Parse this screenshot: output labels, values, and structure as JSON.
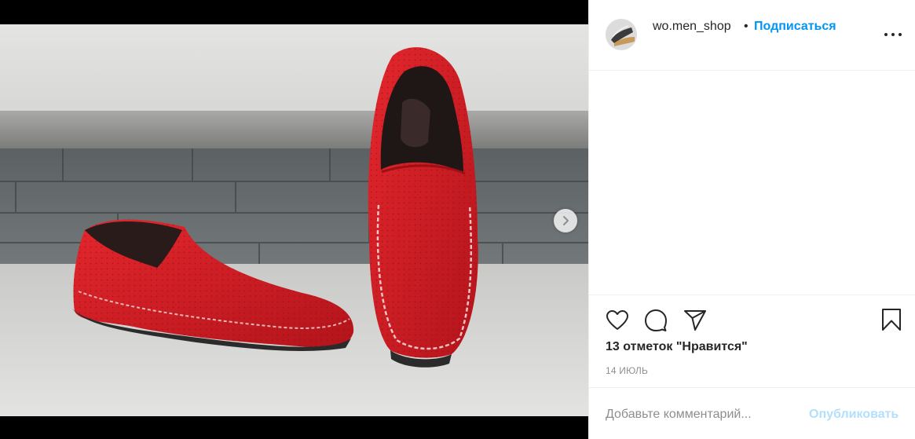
{
  "post": {
    "image_alt": "Red suede moccasins",
    "next_icon": "chevron-right-icon"
  },
  "header": {
    "username": "wo.men_shop",
    "separator": "•",
    "follow_label": "Подписаться",
    "more_icon": "more-horizontal-icon"
  },
  "actions": {
    "icons": [
      "heart-icon",
      "comment-icon",
      "share-icon",
      "bookmark-icon"
    ],
    "likes_text": "13 отметок \"Нравится\"",
    "date_text": "14 ИЮЛЬ"
  },
  "comment": {
    "placeholder": "Добавьте комментарий...",
    "publish_label": "Опубликовать"
  },
  "colors": {
    "accent": "#0095f6",
    "accent_disabled": "#b2dffc",
    "text": "#262626",
    "muted": "#8e8e8e",
    "border": "#efefef"
  }
}
